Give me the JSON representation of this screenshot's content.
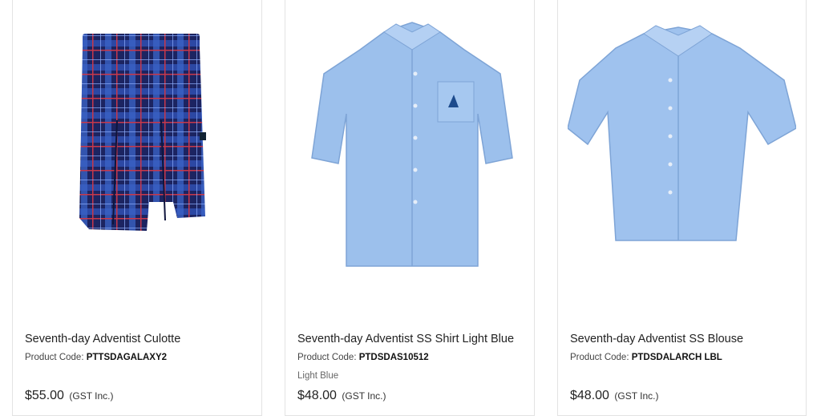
{
  "products": [
    {
      "title": "Seventh-day Adventist Culotte",
      "code_label": "Product Code:",
      "code": "PTTSDAGALAXY2",
      "variant": "",
      "price": "$55.00",
      "tax_note": "(GST Inc.)",
      "image_icon": "plaid-culotte-image",
      "colors": {
        "base": "#1e2a78",
        "stripe": "#3b6fd8",
        "accent": "#c03040"
      }
    },
    {
      "title": "Seventh-day Adventist SS Shirt Light Blue",
      "code_label": "Product Code:",
      "code": "PTDSDAS10512",
      "variant": "Light Blue",
      "price": "$48.00",
      "tax_note": "(GST Inc.)",
      "image_icon": "light-blue-shirt-image",
      "colors": {
        "base": "#9cc0ec"
      }
    },
    {
      "title": "Seventh-day Adventist SS Blouse",
      "code_label": "Product Code:",
      "code": "PTDSDALARCH LBL",
      "variant": "",
      "price": "$48.00",
      "tax_note": "(GST Inc.)",
      "image_icon": "light-blue-blouse-image",
      "colors": {
        "base": "#9fc2ee"
      }
    }
  ]
}
